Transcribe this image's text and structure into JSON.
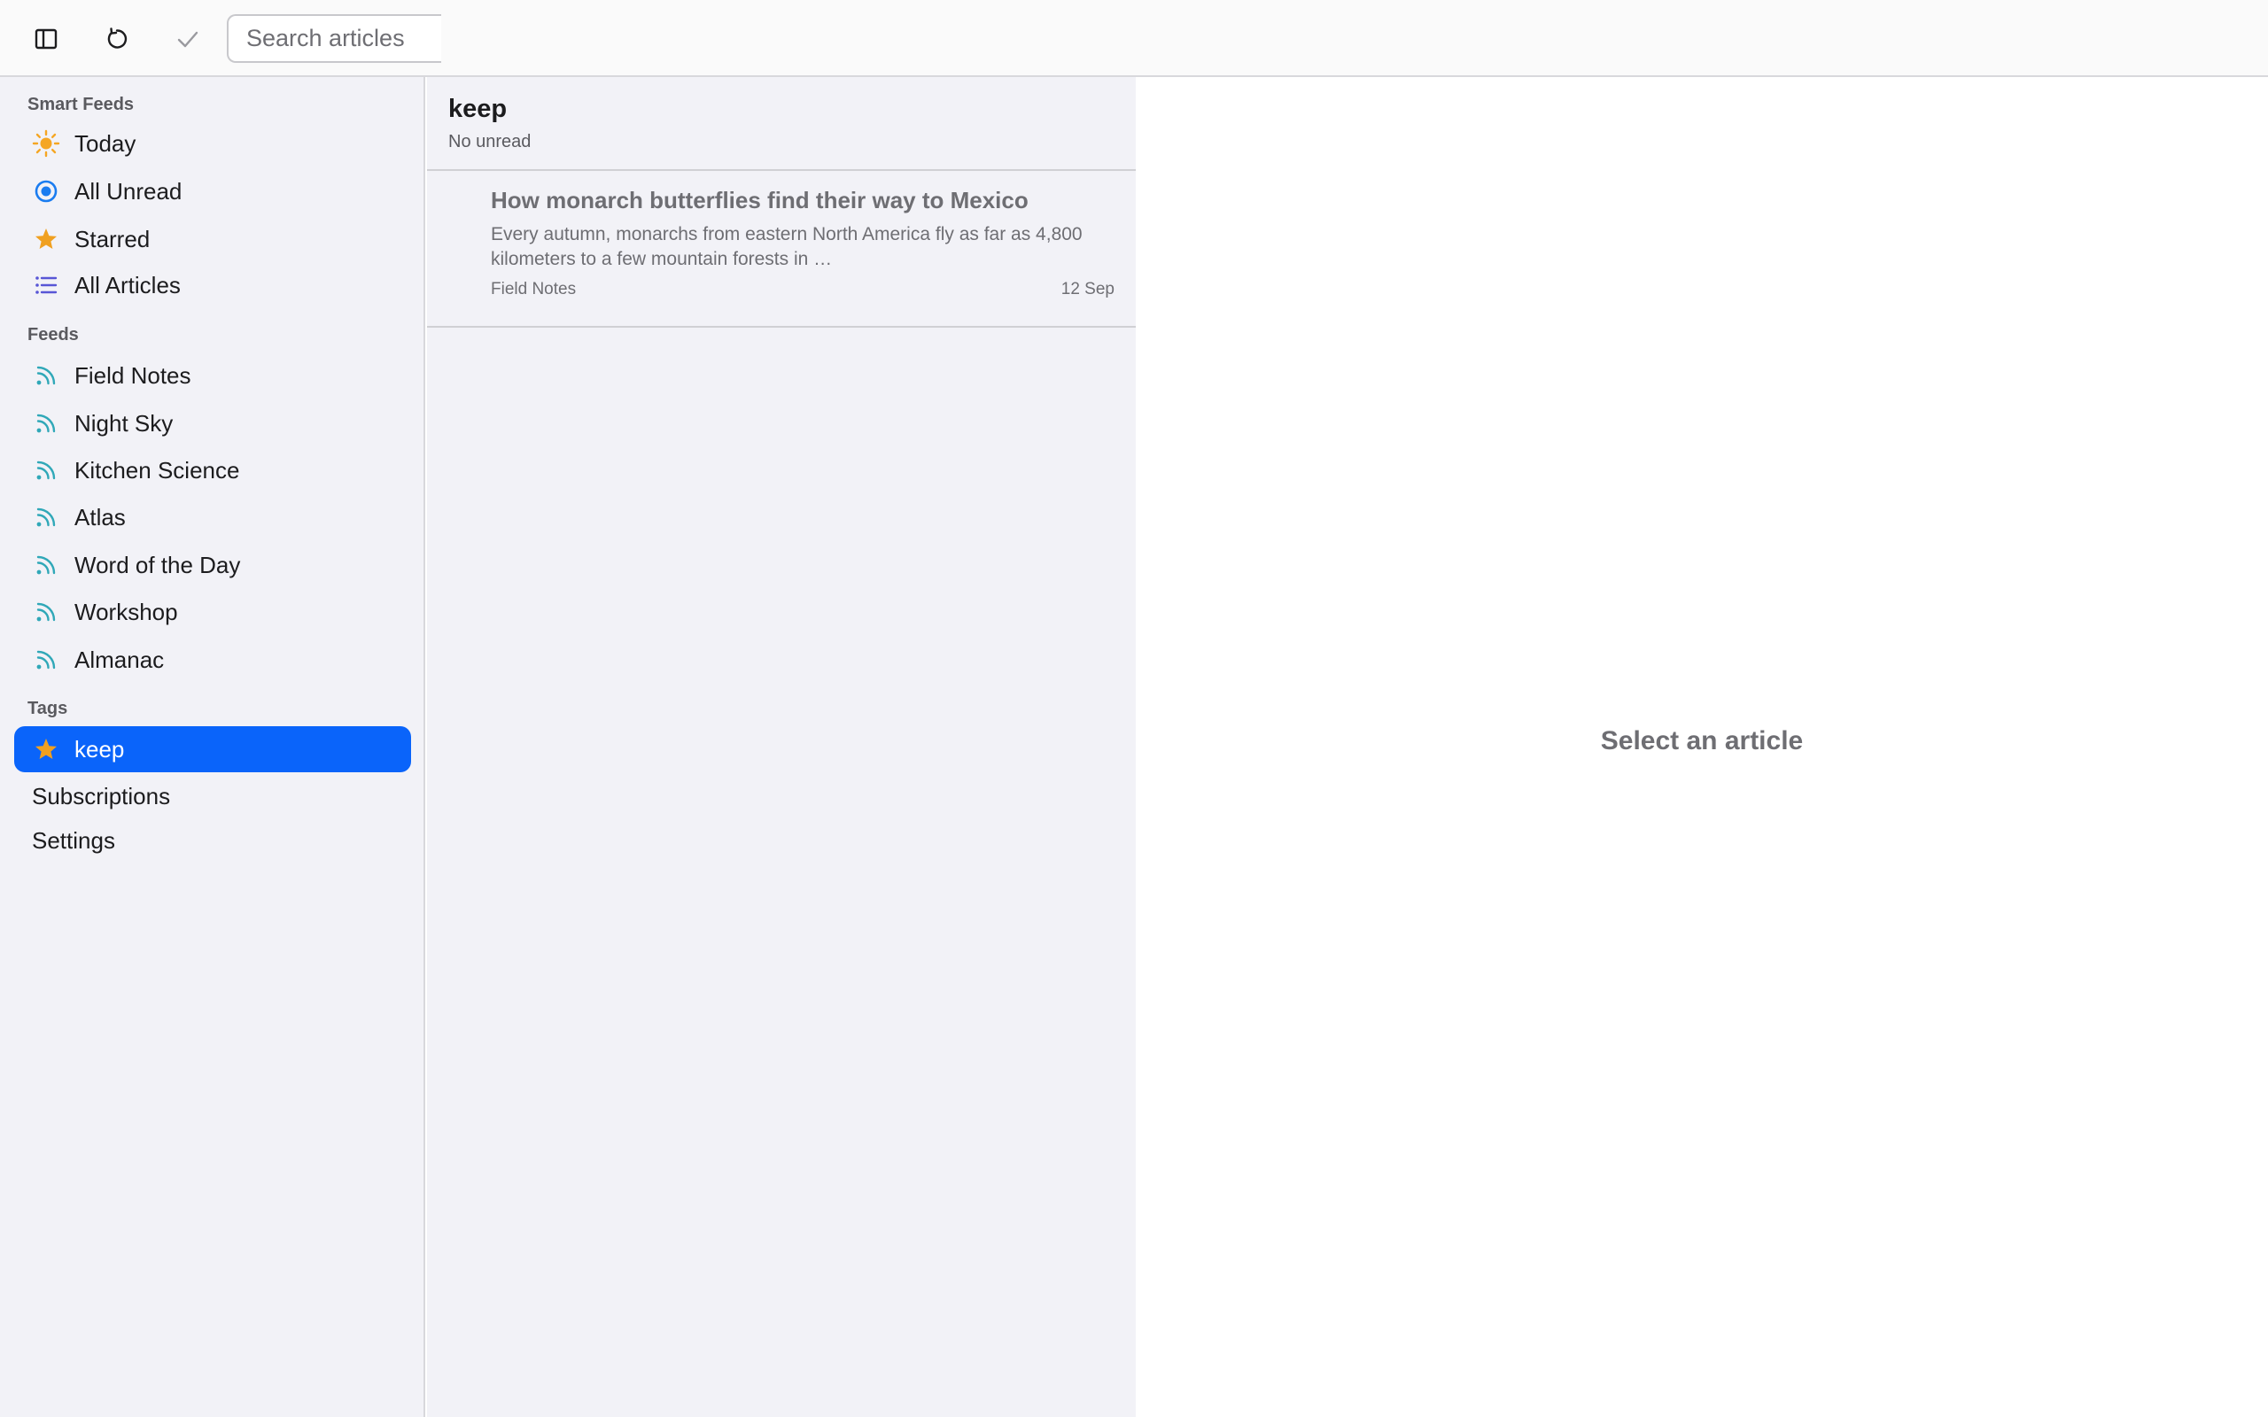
{
  "toolbar": {
    "sidebar_toggle_icon": "sidebar-toggle-icon",
    "refresh_icon": "refresh-icon",
    "mark_read_icon": "checkmark-icon",
    "search_placeholder": "Search articles",
    "search_value": ""
  },
  "sidebar": {
    "smart_feeds_header": "Smart Feeds",
    "smart_feeds": [
      {
        "label": "Today",
        "icon": "sun-icon"
      },
      {
        "label": "All Unread",
        "icon": "unread-circle-icon"
      },
      {
        "label": "Starred",
        "icon": "star-icon"
      },
      {
        "label": "All Articles",
        "icon": "list-icon"
      }
    ],
    "feeds_header": "Feeds",
    "feeds": [
      {
        "label": "Field Notes",
        "icon": "rss-icon"
      },
      {
        "label": "Night Sky",
        "icon": "rss-icon"
      },
      {
        "label": "Kitchen Science",
        "icon": "rss-icon"
      },
      {
        "label": "Atlas",
        "icon": "rss-icon"
      },
      {
        "label": "Word of the Day",
        "icon": "rss-icon"
      },
      {
        "label": "Workshop",
        "icon": "rss-icon"
      },
      {
        "label": "Almanac",
        "icon": "rss-icon"
      }
    ],
    "tags_header": "Tags",
    "tags": [
      {
        "label": "keep",
        "icon": "star-icon",
        "selected": true
      }
    ],
    "subscriptions_label": "Subscriptions",
    "settings_label": "Settings"
  },
  "article_list": {
    "title": "keep",
    "subtitle": "No unread",
    "articles": [
      {
        "title": "How monarch butterflies find their way to Mexico",
        "excerpt": "Every autumn, monarchs from eastern North America fly as far as 4,800 kilometers to a few mountain forests in …",
        "feed": "Field Notes",
        "date": "12 Sep"
      }
    ]
  },
  "detail": {
    "placeholder": "Select an article"
  },
  "colors": {
    "accent": "#0a64fa",
    "sun": "#f5a623",
    "star": "#f0a020",
    "unread": "#1a7cf0",
    "list": "#5856d6",
    "rss": "#30a8b8"
  }
}
